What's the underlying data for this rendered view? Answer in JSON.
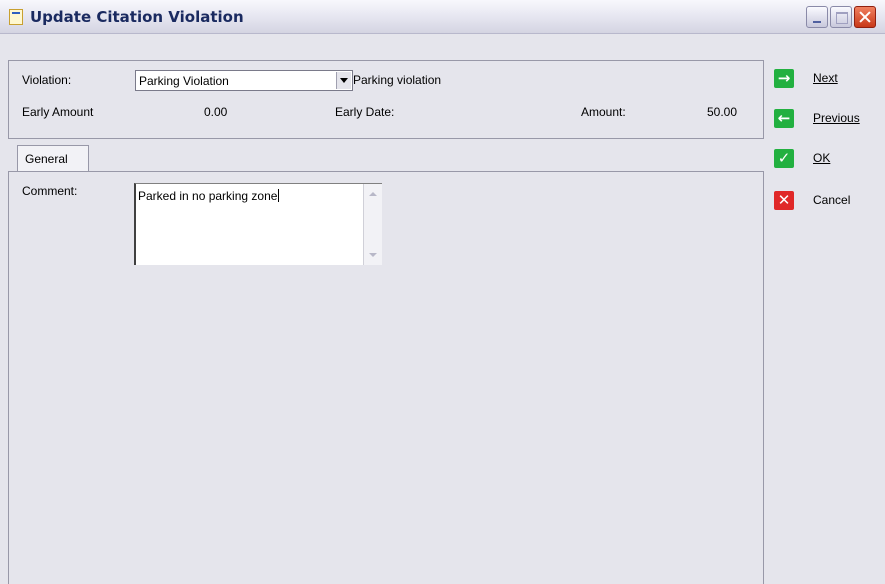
{
  "window": {
    "title": "Update Citation Violation"
  },
  "header": {
    "violation_label": "Violation:",
    "violation_value": "Parking Violation",
    "violation_description": "Parking violation",
    "early_amount_label": "Early Amount",
    "early_amount_value": "0.00",
    "early_date_label": "Early Date:",
    "amount_label": "Amount:",
    "amount_value": "50.00"
  },
  "tabs": [
    {
      "label": "General",
      "selected": true
    }
  ],
  "general": {
    "comment_label": "Comment:",
    "comment_value": "Parked in no parking zone"
  },
  "actions": [
    {
      "label": "Next",
      "icon": "arrow-right-icon",
      "color": "#22b040"
    },
    {
      "label": "Previous",
      "icon": "arrow-left-icon",
      "color": "#22b040"
    },
    {
      "label": "OK",
      "icon": "check-icon",
      "color": "#22b040"
    },
    {
      "label": "Cancel",
      "icon": "x-icon",
      "color": "#e02828"
    }
  ]
}
